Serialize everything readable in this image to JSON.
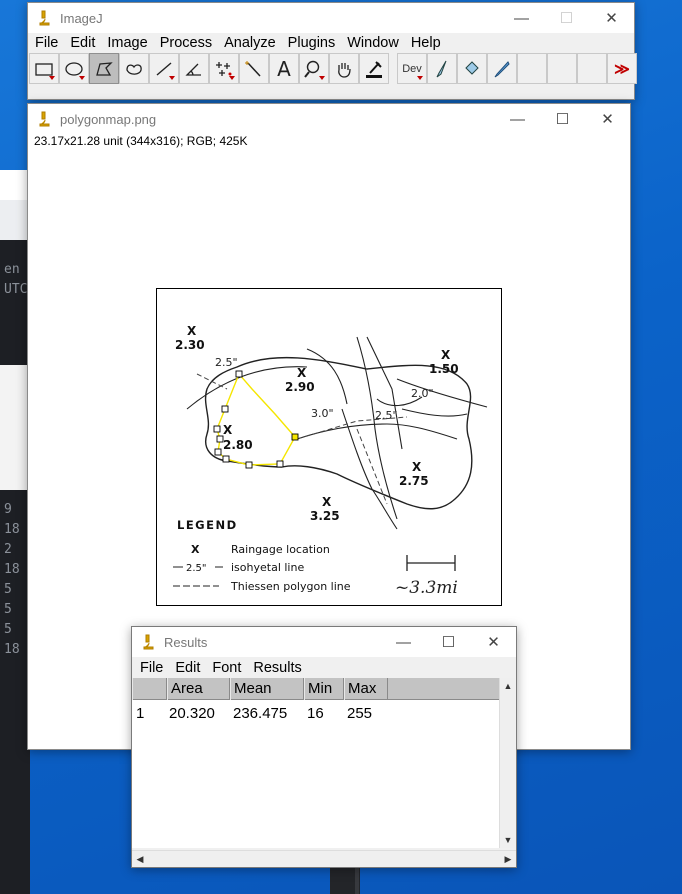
{
  "background_terminal": {
    "lines_top": [
      "en",
      "UTC"
    ],
    "lines_bottom": [
      "9  [",
      "18",
      "2  [",
      "18",
      "5  [",
      "5  [",
      "5  [",
      "18"
    ]
  },
  "imagej": {
    "title": "ImageJ",
    "menu": [
      "File",
      "Edit",
      "Image",
      "Process",
      "Analyze",
      "Plugins",
      "Window",
      "Help"
    ],
    "tools": [
      "rectangle-tool",
      "oval-tool",
      "polygon-tool",
      "freehand-tool",
      "line-tool",
      "angle-tool",
      "multipoint-tool",
      "wand-tool",
      "text-tool",
      "magnifier-tool",
      "hand-tool",
      "color-picker-tool",
      "dev-tool",
      "brush-tool",
      "flood-fill-tool",
      "pencil-tool",
      "more-tools"
    ],
    "dev_label": "Dev",
    "text_tool_glyph": "A",
    "more_glyph": "≫"
  },
  "image_window": {
    "title": "polygonmap.png",
    "info": "23.17x21.28 unit (344x316); RGB; 425K"
  },
  "map": {
    "stations": [
      {
        "label": "2.30"
      },
      {
        "label": "2.90"
      },
      {
        "label": "1.50"
      },
      {
        "label": "2.80"
      },
      {
        "label": "2.75"
      },
      {
        "label": "3.25"
      }
    ],
    "isohyets": [
      "2.5\"",
      "3.0\"",
      "2.5\"",
      "2.0\""
    ],
    "legend_title": "LEGEND",
    "legend_items": [
      "Raingage location",
      "isohyetal line",
      "Thiessen polygon line"
    ],
    "legend_isohyet_value": "2.5\"",
    "scale": "~3.3mi",
    "station_marker": "X"
  },
  "results": {
    "title": "Results",
    "menu": [
      "File",
      "Edit",
      "Font",
      "Results"
    ],
    "columns": [
      "",
      "Area",
      "Mean",
      "Min",
      "Max"
    ],
    "rows": [
      {
        "index": "1",
        "area": "20.320",
        "mean": "236.475",
        "min": "16",
        "max": "255"
      }
    ]
  },
  "window_controls": {
    "minimize": "—",
    "maximize": "☐",
    "close": "✕"
  },
  "colors": {
    "desktop": "#0b63c9",
    "selection": "#f5e600",
    "accent_red": "#c00000"
  }
}
